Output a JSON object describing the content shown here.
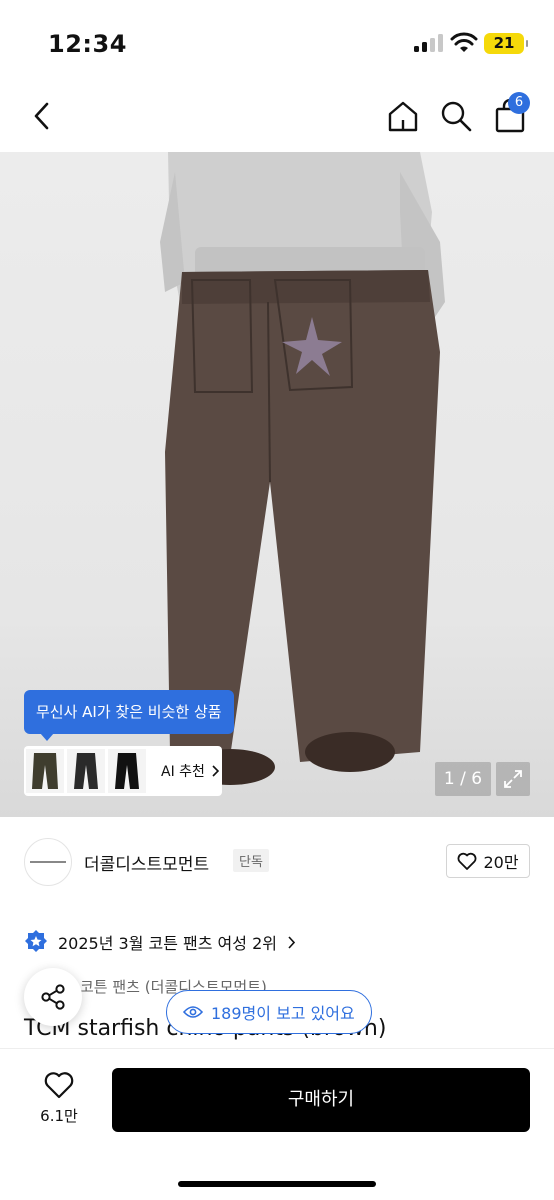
{
  "status_bar": {
    "time": "12:34",
    "battery": "21"
  },
  "nav": {
    "cart_count": "6"
  },
  "gallery": {
    "ai_tooltip": "무신사 AI가 찾은 비슷한 상품",
    "ai_recommend_label": "AI 추천",
    "counter": "1 / 6"
  },
  "brand": {
    "name": "더콜디스트모먼트",
    "tag": "단독",
    "likes": "20만"
  },
  "ranking": {
    "text": "2025년 3월 코튼 팬츠 여성 2위"
  },
  "product": {
    "category": "코튼 팬츠 (더콜디스트모먼트)",
    "title": "TCM starfish chino pants (brown)"
  },
  "viewers": {
    "text": "189명이 보고 있어요"
  },
  "bottom": {
    "wish_count": "6.1만",
    "buy_label": "구매하기"
  },
  "colors": {
    "accent": "#2f6fde",
    "pants": "#5a4a43",
    "sweatshirt": "#cfcfcf"
  }
}
